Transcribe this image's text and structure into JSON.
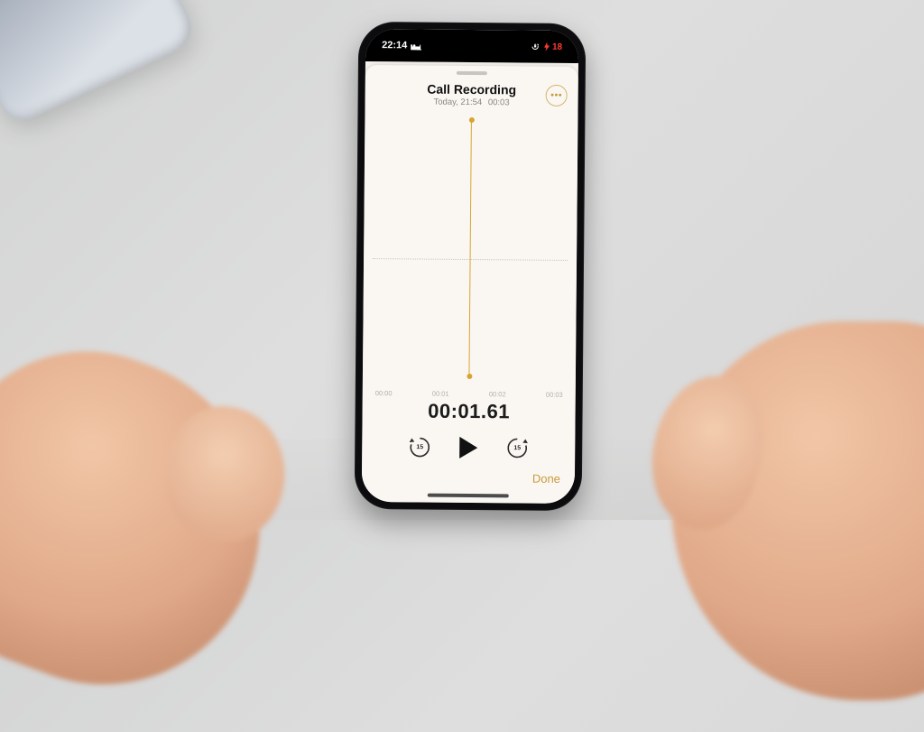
{
  "statusbar": {
    "time": "22:14",
    "battery_pct": "18"
  },
  "sheet": {
    "title": "Call Recording",
    "date": "Today, 21:54",
    "duration": "00:03",
    "ticks": [
      "00:00",
      "00:01",
      "00:02",
      "00:03"
    ],
    "timecode": "00:01.61",
    "skip_back_seconds": "15",
    "skip_fwd_seconds": "15",
    "done_label": "Done"
  }
}
